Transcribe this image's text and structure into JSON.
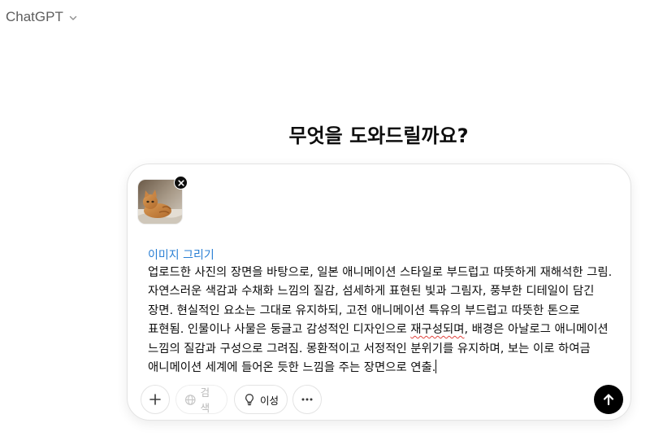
{
  "header": {
    "model_name": "ChatGPT"
  },
  "main": {
    "headline": "무엇을 도와드릴까요?"
  },
  "composer": {
    "attachment": {
      "alt": "cat photo"
    },
    "tool_label": "이미지 그리기",
    "prompt_parts": [
      "업로드한 사진의 장면을 바탕으로, 일본 애니메이션 스타일로 부드럽고 따뜻하게 재해석한 그림. 자연스러운 색감과 수채화 느낌의 질감, 섬세하게 표현된 빛과 그림자, 풍부한 디테일이 담긴 장면. 현실적인 요소는 그대로 유지하되, 고전 애니메이션 특유의 부드럽고 따뜻한 톤으로 표현됨. 인물이나 사물은 둥글고 감성적인 디자인으로 ",
      "재구성되며",
      ", 배경은 아날로그 애니메이션 느낌의 질감과 구성으로 그려짐. 몽환적이고 서정적인 분위기를 유지하며, 보는 이로 하여금 애니메이션 세계에 들어온 듯한 느낌을 주는 장면으로 연출."
    ],
    "toolbar": {
      "search_label": "검색",
      "reason_label": "이성"
    }
  },
  "colors": {
    "accent_blue": "#2a7fd4",
    "send_button": "#000000",
    "muted_text": "#5d5d5d"
  },
  "icons": {
    "model_chevron": "chevron-down-icon",
    "attach": "plus-icon",
    "search": "globe-icon",
    "reason": "lightbulb-icon",
    "more": "ellipsis-icon",
    "send": "arrow-up-icon",
    "remove": "close-icon"
  }
}
